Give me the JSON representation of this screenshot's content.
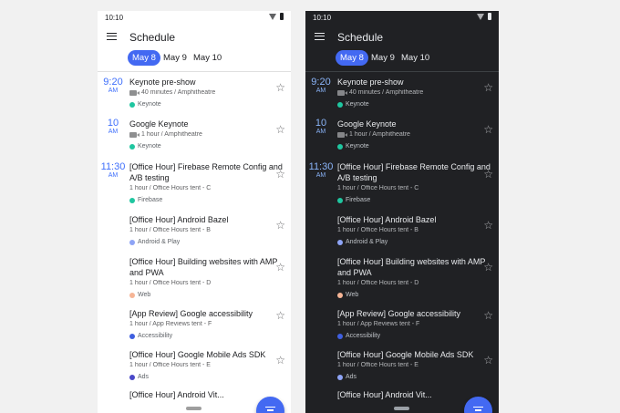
{
  "status": {
    "time": "10:10"
  },
  "app": {
    "title": "Schedule"
  },
  "dates": [
    "May 8",
    "May 9",
    "May 10"
  ],
  "times": [
    {
      "time": "9:20",
      "ampm": "AM"
    },
    {
      "time": "10",
      "ampm": "AM"
    },
    {
      "time": "11:30",
      "ampm": "AM"
    }
  ],
  "sessions": [
    {
      "title": "Keynote pre-show",
      "subtitle": "40 minutes / Amphitheatre",
      "tag": "Keynote"
    },
    {
      "title": "Google Keynote",
      "subtitle": "1 hour / Amphitheatre",
      "tag": "Keynote"
    },
    {
      "title": "[Office Hour] Firebase Remote Config and A/B testing",
      "subtitle": "1 hour / Office Hours tent - C",
      "tag": "Firebase"
    },
    {
      "title": "[Office Hour] Android Bazel",
      "subtitle": "1 hour / Office Hours tent - B",
      "tag": "Android & Play"
    },
    {
      "title": "[Office Hour] Building websites with AMP and PWA",
      "subtitle": "1 hour / Office Hours tent - D",
      "tag": "Web"
    },
    {
      "title": "[App Review] Google accessibility",
      "subtitle": "1 hour / App Reviews tent - F",
      "tag": "Accessibility"
    },
    {
      "title": "[Office Hour] Google Mobile Ads SDK",
      "subtitle": "1 hour / Office Hours tent - E",
      "tag": "Ads"
    },
    {
      "title": "[Office Hour] Android Vit...",
      "subtitle": "",
      "tag": ""
    }
  ],
  "colors": {
    "accent": "#4369f2",
    "tag_keynote": "#1fc6a0",
    "tag_firebase": "#1fc6a0",
    "tag_android": "#8ea4f6",
    "tag_web": "#f6b596",
    "tag_accessibility": "#3f5fe0",
    "tag_ads": "#4a48c8"
  }
}
